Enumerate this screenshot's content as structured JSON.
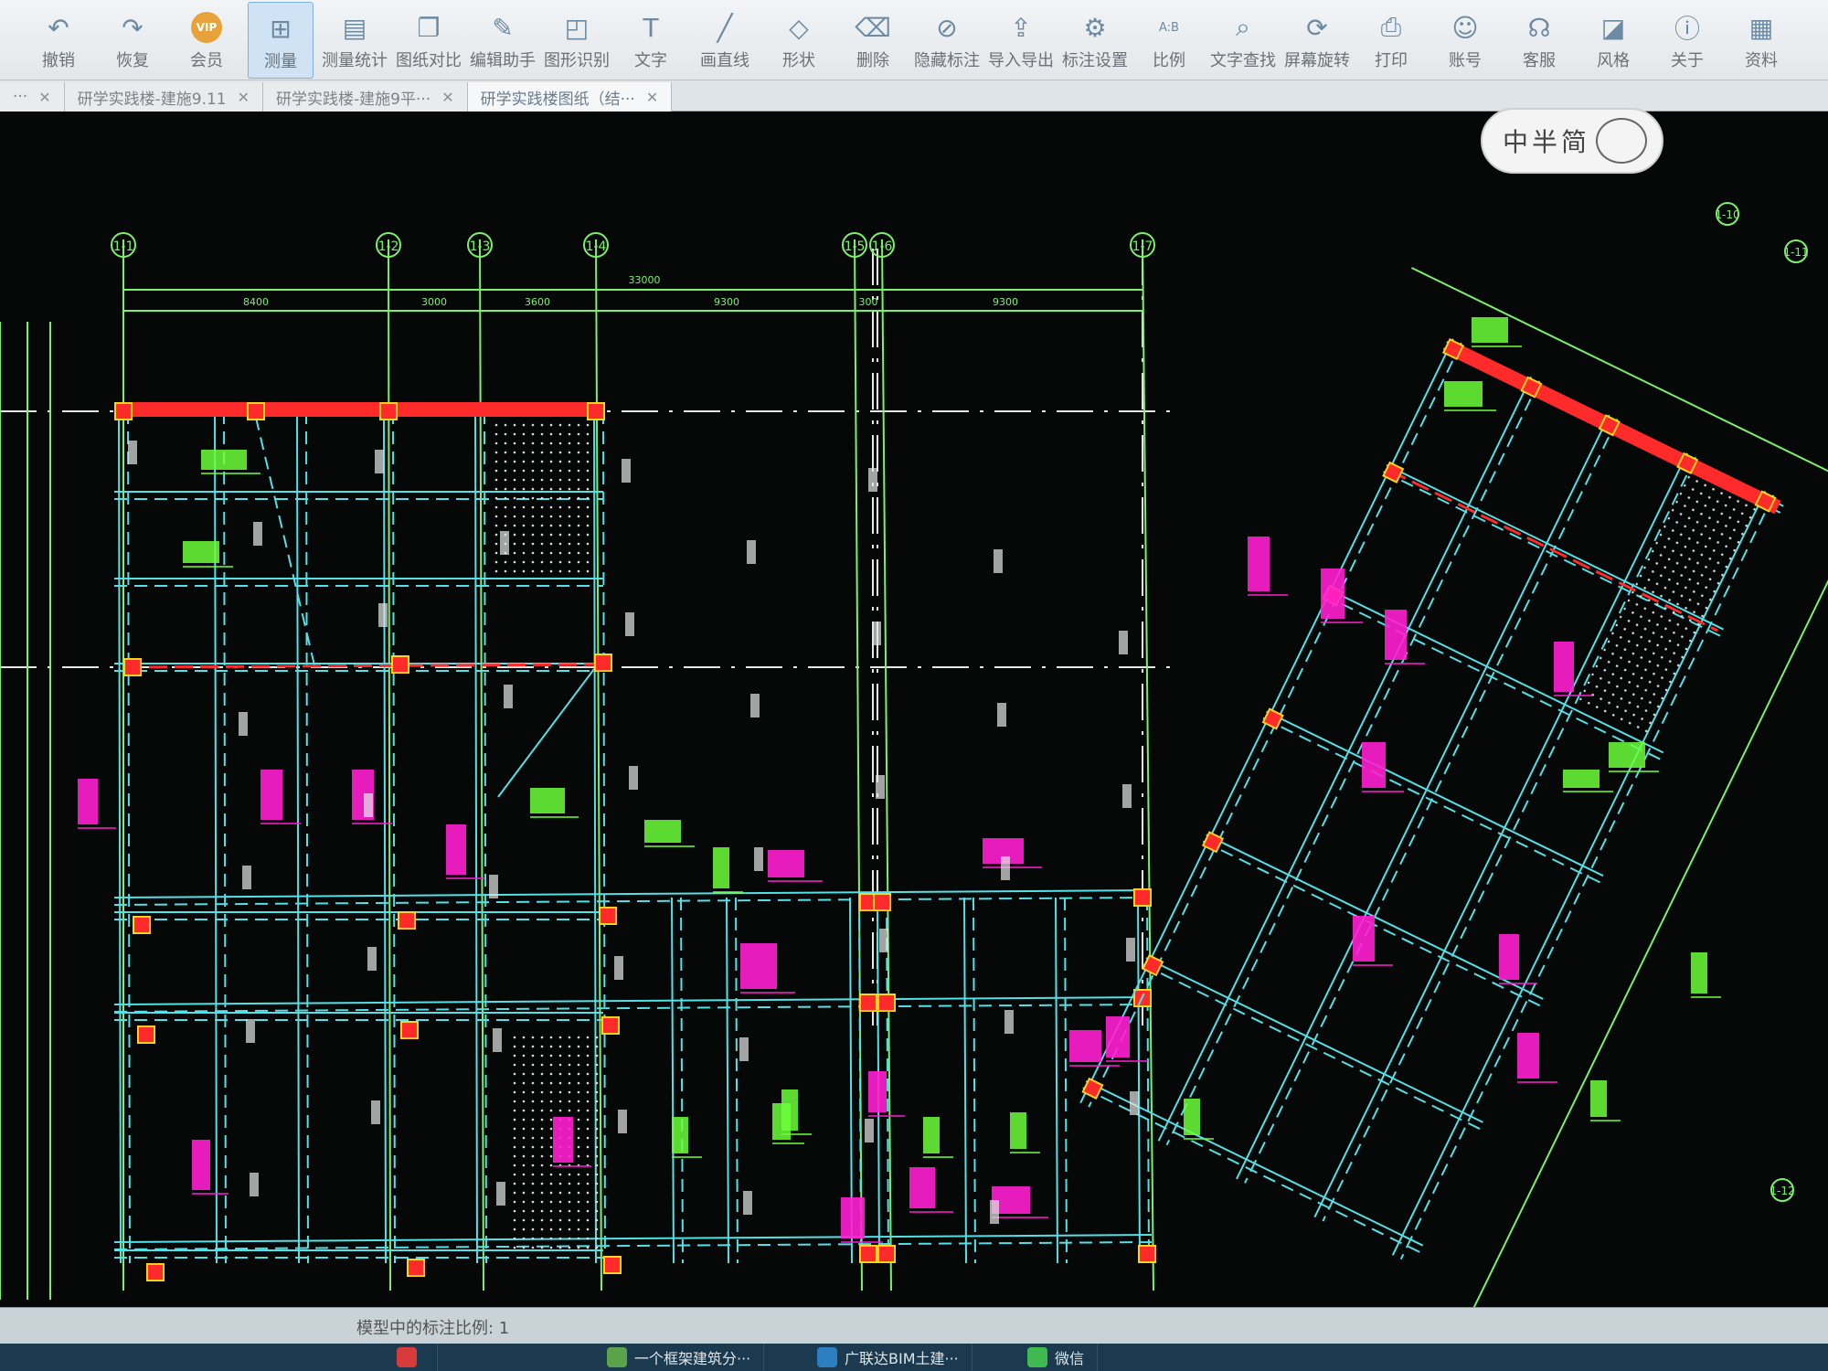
{
  "toolbar": {
    "tools": [
      {
        "label": "撤销",
        "icon": "undo-icon"
      },
      {
        "label": "恢复",
        "icon": "redo-icon"
      },
      {
        "label": "会员",
        "icon": "vip-icon",
        "badge": "VIP"
      },
      {
        "label": "测量",
        "icon": "measure-icon",
        "active": true
      },
      {
        "label": "测量统计",
        "icon": "measure-stats-icon"
      },
      {
        "label": "图纸对比",
        "icon": "compare-icon"
      },
      {
        "label": "编辑助手",
        "icon": "edit-assistant-icon"
      },
      {
        "label": "图形识别",
        "icon": "shape-recognition-icon"
      },
      {
        "label": "文字",
        "icon": "text-icon"
      },
      {
        "label": "画直线",
        "icon": "line-icon"
      },
      {
        "label": "形状",
        "icon": "shape-icon"
      },
      {
        "label": "删除",
        "icon": "eraser-icon"
      },
      {
        "label": "隐藏标注",
        "icon": "hide-annotation-icon"
      },
      {
        "label": "导入导出",
        "icon": "import-export-icon"
      },
      {
        "label": "标注设置",
        "icon": "annotation-settings-icon"
      },
      {
        "label": "比例",
        "icon": "scale-icon",
        "badge": "A:B"
      },
      {
        "label": "文字查找",
        "icon": "text-search-icon"
      },
      {
        "label": "屏幕旋转",
        "icon": "rotate-screen-icon"
      },
      {
        "label": "打印",
        "icon": "print-icon"
      },
      {
        "label": "账号",
        "icon": "account-icon"
      },
      {
        "label": "客服",
        "icon": "headset-icon"
      },
      {
        "label": "风格",
        "icon": "style-icon"
      },
      {
        "label": "关于",
        "icon": "info-icon"
      },
      {
        "label": "资料",
        "icon": "resources-icon"
      }
    ]
  },
  "tabs": [
    {
      "label": "···",
      "close": "✕"
    },
    {
      "label": "研学实践楼-建施9.11",
      "close": "✕"
    },
    {
      "label": "研学实践楼-建施9平···",
      "close": "✕"
    },
    {
      "label": "研学实践楼图纸（结···",
      "close": "✕",
      "active": true
    }
  ],
  "ime": {
    "label": "中半简"
  },
  "status": {
    "text": "模型中的标注比例: 1"
  },
  "taskbar": [
    {
      "label": "",
      "color": "#d63a3a"
    },
    {
      "label": "一个框架建筑分···",
      "color": "#5aa34a"
    },
    {
      "label": "广联达BIM土建···",
      "color": "#2d7fc1"
    },
    {
      "label": "微信",
      "color": "#3fb950"
    }
  ],
  "drawing": {
    "axis_labels_top": [
      "1-1",
      "1-2",
      "1-3",
      "1-4",
      "1-5",
      "1-6",
      "1-7"
    ],
    "axis_labels_right": [
      "1-10",
      "1-11",
      "1-12"
    ],
    "dimensions_top": [
      "8400",
      "3000",
      "3600",
      "9300",
      "300",
      "9300"
    ],
    "dimension_total": "33000",
    "colors": {
      "background": "#050807",
      "beam": "#55e0e6",
      "axis": "#7cf06a",
      "grid": "#e8e8e8",
      "column": "#ff2b2b",
      "tag_magenta": "#ff1fd0",
      "tag_green": "#6cff3a"
    }
  }
}
